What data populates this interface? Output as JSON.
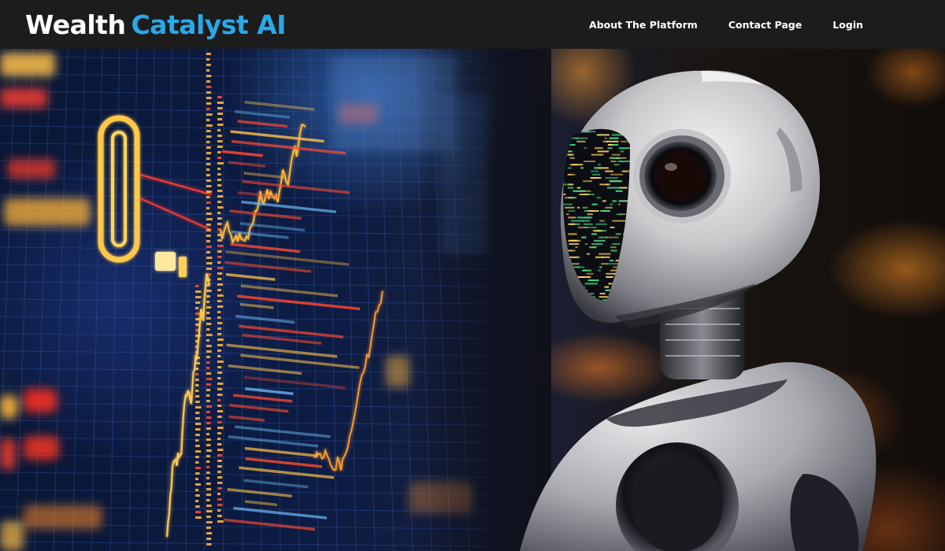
{
  "brand": {
    "word1": "Wealth",
    "word2": "Catalyst AI",
    "color_primary": "#ffffff",
    "color_accent": "#2aa9e8"
  },
  "nav": {
    "items": [
      {
        "label": "About The Platform"
      },
      {
        "label": "Contact Page"
      },
      {
        "label": "Login"
      }
    ]
  },
  "hero": {
    "image_subject": "robot-viewing-financial-chart-screens",
    "icon_names": [
      "robot-illustration",
      "trading-chart-display"
    ]
  },
  "colors": {
    "header_bg": "#1c1c1d",
    "chart_orange": "#ffb33a",
    "chart_red": "#ff4d2e",
    "chart_blue": "#4a8ff0"
  }
}
